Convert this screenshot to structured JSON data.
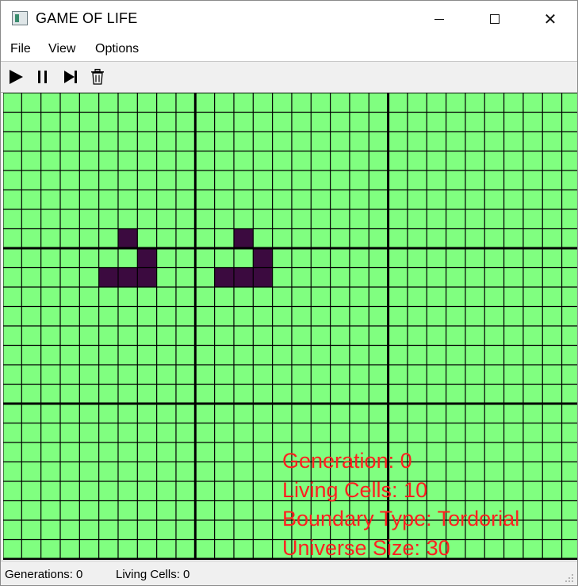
{
  "window": {
    "title": "GAME OF LIFE",
    "icons": {
      "app": "app-window-icon",
      "minimize": "minimize-icon",
      "maximize": "maximize-icon",
      "close": "close-icon"
    }
  },
  "menu": {
    "file": "File",
    "view": "View",
    "options": "Options"
  },
  "toolbar": {
    "play": "play-icon",
    "pause": "pause-icon",
    "next": "step-next-icon",
    "clear": "trash-icon"
  },
  "universe": {
    "columns": 30,
    "rows": 24,
    "cell_color": "#80ff80",
    "live_color": "#3b0a3f",
    "grid_line_color": "#000000",
    "heavy_line_every": 10,
    "living_cells": [
      [
        6,
        7
      ],
      [
        7,
        8
      ],
      [
        5,
        9
      ],
      [
        6,
        9
      ],
      [
        7,
        9
      ],
      [
        12,
        7
      ],
      [
        13,
        8
      ],
      [
        11,
        9
      ],
      [
        12,
        9
      ],
      [
        13,
        9
      ]
    ]
  },
  "hud": {
    "color": "#ff2020",
    "generation": "Generation: 0",
    "living": "Living Cells: 10",
    "boundary": "Boundary Type: Tordorial",
    "size": "Universe Size: 30"
  },
  "status": {
    "generations": "Generations: 0",
    "living": "Living Cells: 0"
  }
}
